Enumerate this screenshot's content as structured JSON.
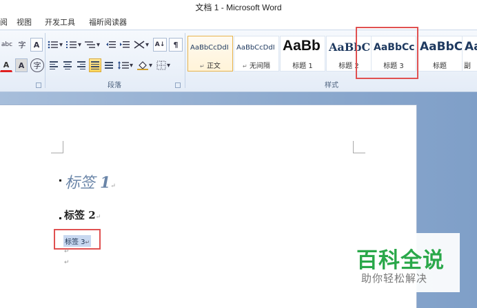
{
  "window": {
    "title": "文档 1 - Microsoft Word"
  },
  "menu": {
    "items": [
      "阅",
      "视图",
      "开发工具",
      "福昕阅读器"
    ]
  },
  "ribbon": {
    "groups": {
      "paragraph": "段落",
      "styles": "样式"
    },
    "font_buttons": {
      "phonetic": "abc",
      "enclose": "字",
      "char_border": "A",
      "font_color": "A",
      "char_shading": "A",
      "enclose_char": "字"
    },
    "para_buttons": {
      "sort": "A↓",
      "marks": "¶"
    },
    "styles": [
      {
        "sample": "AaBbCcDdI",
        "name": "正文",
        "mark": "↵",
        "selected": true
      },
      {
        "sample": "AaBbCcDdI",
        "name": "无间隔",
        "mark": "↵",
        "selected": false
      },
      {
        "sample": "AaBb",
        "name": "标题 1",
        "mark": "",
        "selected": false
      },
      {
        "sample": "AaBbC",
        "name": "标题 2",
        "mark": "",
        "selected": false
      },
      {
        "sample": "AaBbCc",
        "name": "标题 3",
        "mark": "",
        "selected": false
      },
      {
        "sample": "AaBbC",
        "name": "标题",
        "mark": "",
        "selected": false
      },
      {
        "sample": "Aa",
        "name": "副",
        "mark": "",
        "selected": false
      }
    ]
  },
  "document": {
    "heading1": {
      "text": "标签",
      "num": "1",
      "mark": "↵"
    },
    "heading2": {
      "text": "标签 2",
      "mark": "↵"
    },
    "label3": {
      "text": "标签 3",
      "mark": "↵"
    },
    "empty_marks": [
      "↵",
      "↵"
    ]
  },
  "watermark": {
    "title": "百科全说",
    "subtitle": "助你轻松解决"
  },
  "colors": {
    "highlight_box": "#e05050",
    "watermark_green": "#2aa84a",
    "heading1_color": "#6a85a8"
  }
}
